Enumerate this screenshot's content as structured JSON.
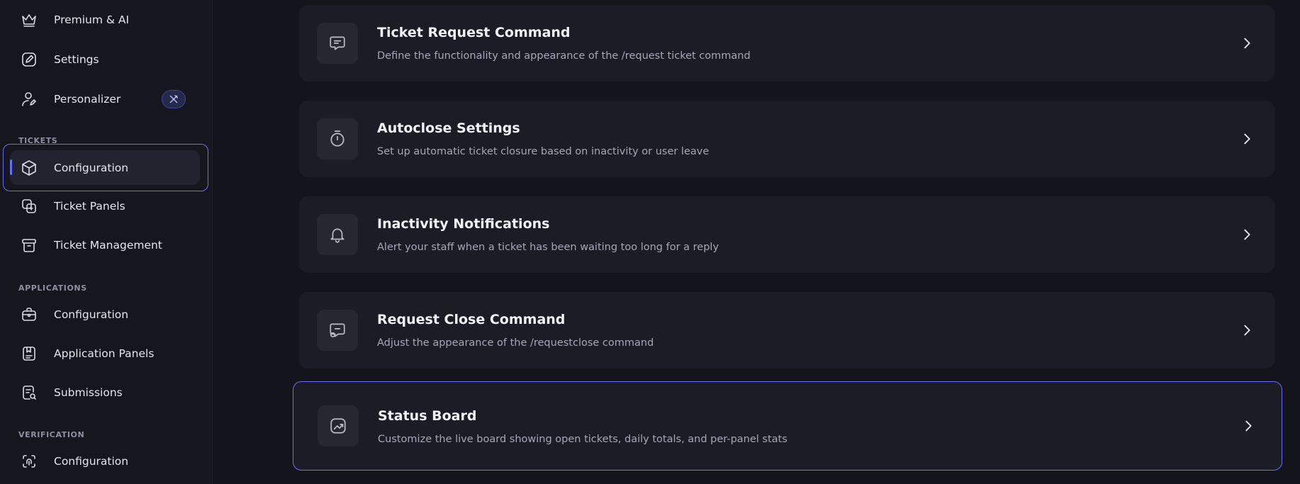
{
  "sidebar": {
    "top_items": [
      {
        "label": "Premium & AI",
        "icon": "crown-icon"
      },
      {
        "label": "Settings",
        "icon": "edit-icon"
      },
      {
        "label": "Personalizer",
        "icon": "user-edit-icon",
        "badge_icon": "tools-icon"
      }
    ],
    "sections": {
      "tickets": {
        "title": "TICKETS",
        "items": [
          {
            "label": "Configuration",
            "icon": "cube-icon",
            "active": true
          },
          {
            "label": "Ticket Panels",
            "icon": "panels-add-icon"
          },
          {
            "label": "Ticket Management",
            "icon": "archive-icon"
          }
        ]
      },
      "applications": {
        "title": "APPLICATIONS",
        "items": [
          {
            "label": "Configuration",
            "icon": "briefcase-icon"
          },
          {
            "label": "Application Panels",
            "icon": "document-bookmark-icon"
          },
          {
            "label": "Submissions",
            "icon": "document-search-icon"
          }
        ]
      },
      "verification": {
        "title": "VERIFICATION",
        "items": [
          {
            "label": "Configuration",
            "icon": "fingerprint-icon"
          }
        ]
      }
    }
  },
  "cards": [
    {
      "title": "Ticket Request Command",
      "description": "Define the functionality and appearance of the /request ticket command",
      "icon": "message-icon"
    },
    {
      "title": "Autoclose Settings",
      "description": "Set up automatic ticket closure based on inactivity or user leave",
      "icon": "stopwatch-icon"
    },
    {
      "title": "Inactivity Notifications",
      "description": "Alert your staff when a ticket has been waiting too long for a reply",
      "icon": "bell-icon"
    },
    {
      "title": "Request Close Command",
      "description": "Adjust the appearance of the /requestclose command",
      "icon": "message-close-icon"
    },
    {
      "title": "Status Board",
      "description": "Customize the live board showing open tickets, daily totals, and per-panel stats",
      "icon": "chart-square-icon"
    }
  ],
  "colors": {
    "accent": "#6b6ef5",
    "background": "#13141c",
    "card": "#1b1c25"
  }
}
